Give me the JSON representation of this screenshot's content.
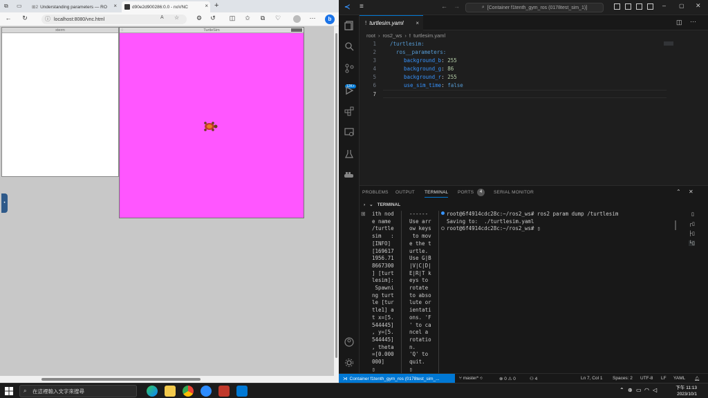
{
  "browser": {
    "tabs": [
      {
        "label": "Understanding parameters — RO"
      },
      {
        "label": "d90e2d900286:0.0 - noVNC"
      }
    ],
    "url": "localhost:8080/vnc.html",
    "vnc": {
      "xterm_title": "xterm",
      "turtlesim_title": "TurtleSim",
      "background_color": "#ff56ff"
    }
  },
  "vscode": {
    "command_center": "[Container f1tenth_gym_ros (0178test_sim_1)]",
    "activity_badge": "12K+",
    "editor_tab": "turtlesim.yaml",
    "breadcrumbs": [
      "root",
      "ros2_ws",
      "turtlesim.yaml"
    ],
    "code_lines": [
      {
        "n": "1",
        "text": "/turtlesim:"
      },
      {
        "n": "2",
        "text": "  ros__parameters:"
      },
      {
        "n": "3",
        "key": "background_b",
        "val": "255"
      },
      {
        "n": "4",
        "key": "background_g",
        "val": "86"
      },
      {
        "n": "5",
        "key": "background_r",
        "val": "255"
      },
      {
        "n": "6",
        "key": "use_sim_time",
        "val": "false"
      },
      {
        "n": "7",
        "text": ""
      }
    ],
    "panel_tabs": [
      "PROBLEMS",
      "OUTPUT",
      "TERMINAL",
      "PORTS",
      "SERIAL MONITOR"
    ],
    "ports_count": "4",
    "terminal_header": "TERMINAL",
    "terminal_col1": "ith nod\ne name\n/turtle\nsim   :\n[INFO]\n[169617\n1956.71\n8667300\n] [turt\nlesim]:\n Spawni\nng turt\nle [tur\ntle1] a\nt x=[5.\n544445]\n, y=[5.\n544445]\n, theta\n=[0.000\n000]\n▯",
    "terminal_col2": "------\nUse arr\now keys\n to mov\ne the t\nurtle.\nUse G|B\n|V|C|D|\nE|R|T k\neys to\nrotate\nto abso\nlute or\nientati\nons. 'F\n' to ca\nncel a\nrotatio\nn.\n'Q' to\nquit.\n▯",
    "terminal_main": [
      "root@6f4914cdc28c:~/ros2_ws# ros2 param dump /turtlesim",
      "Saving to:  ./turtlesim.yaml",
      "root@6f4914cdc28c:~/ros2_ws# ▯"
    ],
    "status": {
      "remote": "Container f1tenth_gym_ros (0178test_sim_...",
      "branch": "master*",
      "problems": "⊗ 0 ⚠ 0",
      "ports": "4",
      "position": "Ln 7, Col 1",
      "spaces": "Spaces: 2",
      "encoding": "UTF-8",
      "eol": "LF",
      "language": "YAML"
    }
  },
  "taskbar": {
    "search_placeholder": "在這裡輸入文字來搜尋",
    "time": "下午 11:13",
    "date": "2023/10/1"
  }
}
